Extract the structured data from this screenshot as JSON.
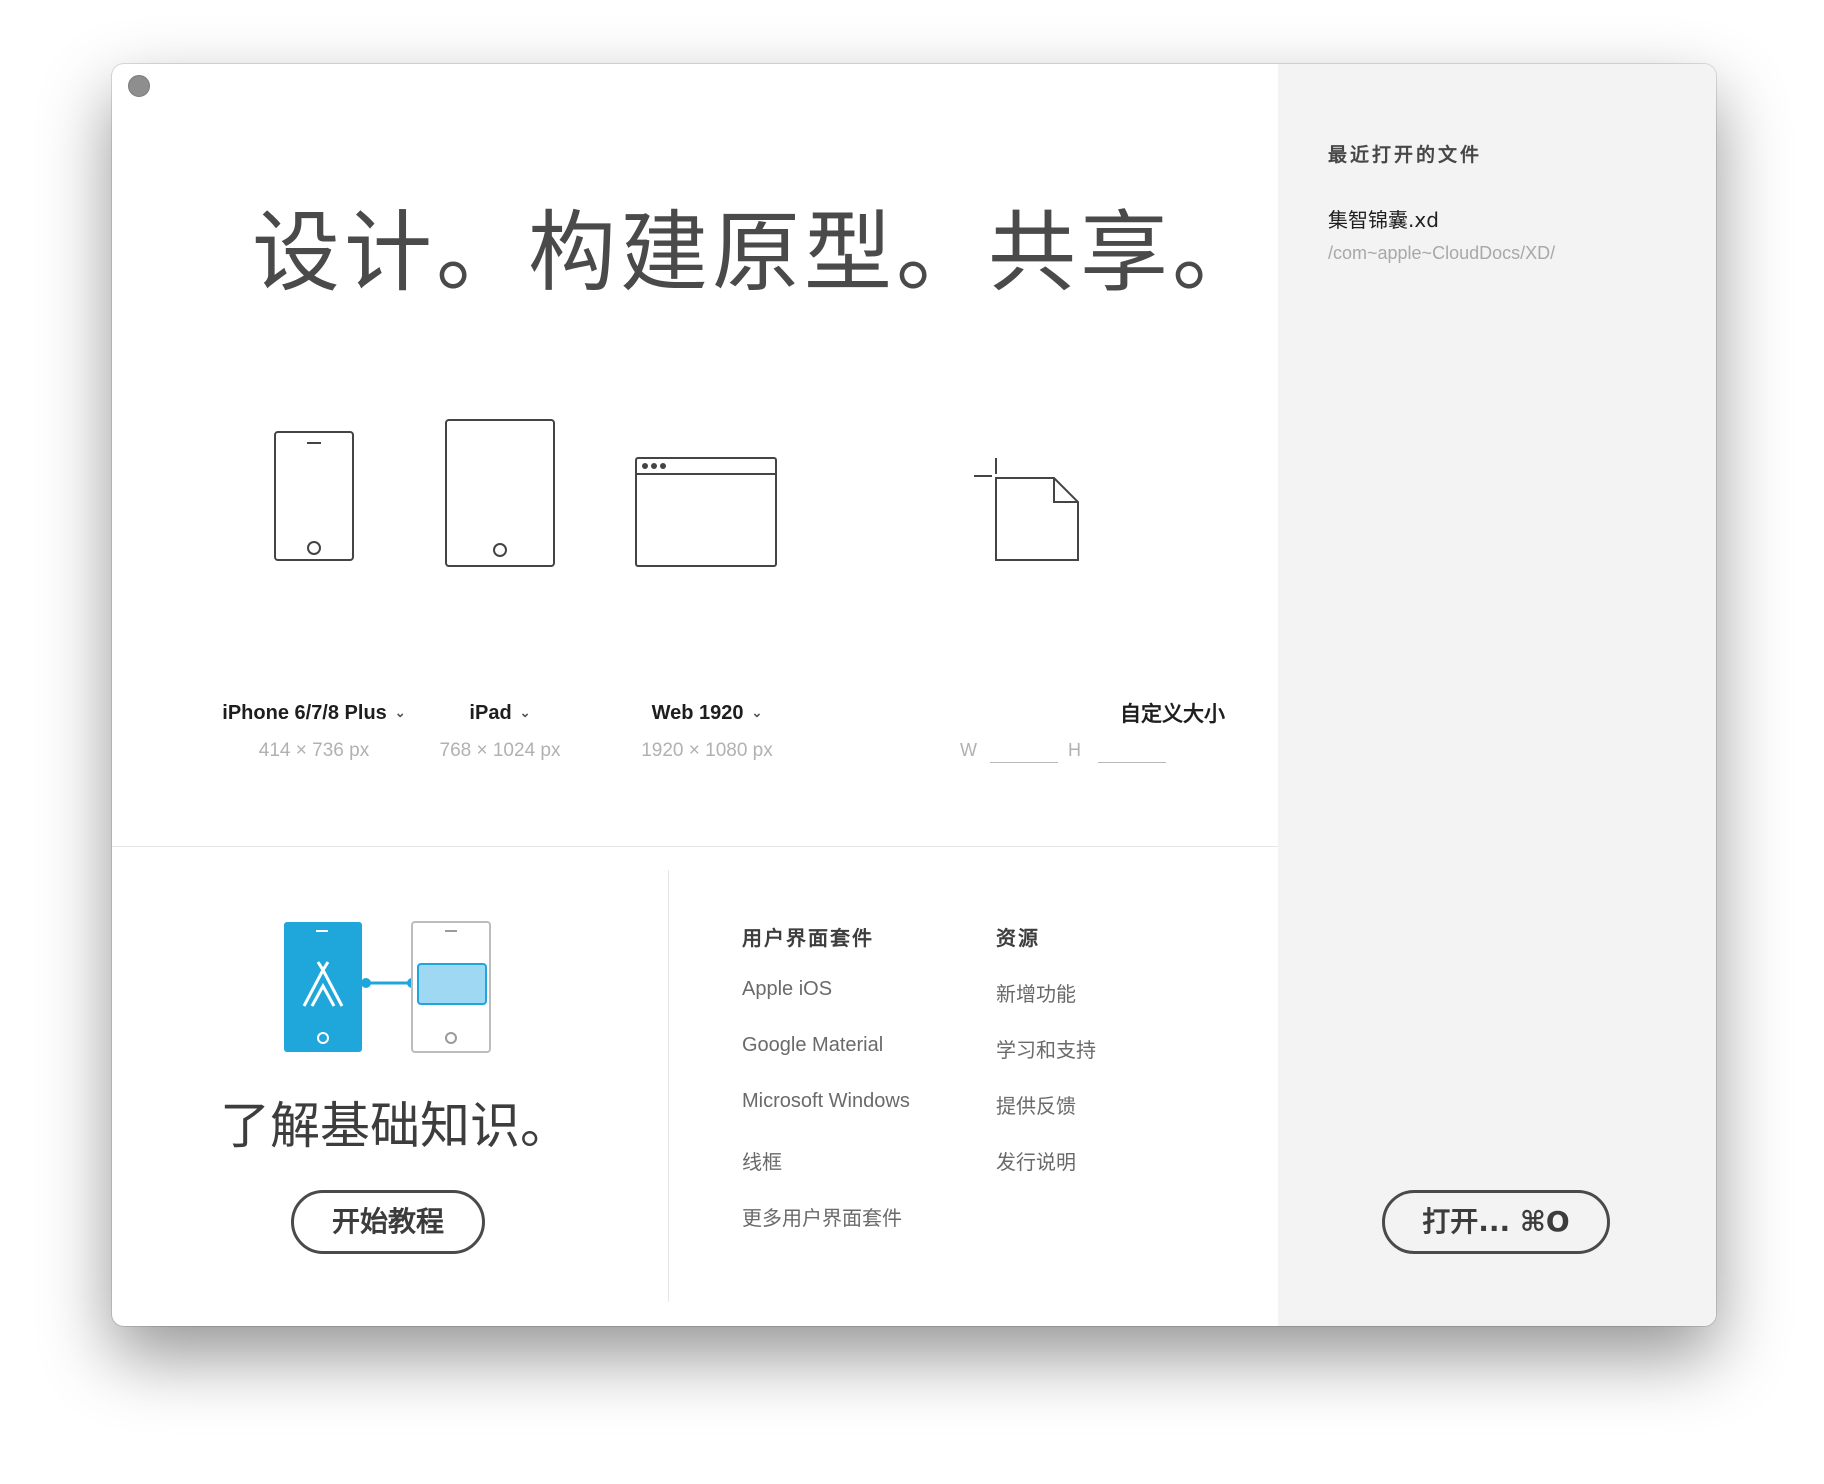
{
  "headline": "设计。构建原型。共享。",
  "presets": [
    {
      "label": "iPhone 6/7/8 Plus",
      "size": "414 × 736 px",
      "icon": "iphone-icon"
    },
    {
      "label": "iPad",
      "size": "768 × 1024 px",
      "icon": "ipad-icon"
    },
    {
      "label": "Web 1920",
      "size": "1920 × 1080 px",
      "icon": "web-browser-icon"
    }
  ],
  "custom": {
    "title": "自定义大小",
    "w_label": "W",
    "h_label": "H",
    "w_value": "",
    "h_value": ""
  },
  "learn": {
    "title": "了解基础知识。",
    "button": "开始教程"
  },
  "ui_kits": {
    "title": "用户界面套件",
    "items": [
      "Apple iOS",
      "Google Material",
      "Microsoft Windows",
      "线框",
      "更多用户界面套件"
    ]
  },
  "resources": {
    "title": "资源",
    "items": [
      "新增功能",
      "学习和支持",
      "提供反馈",
      "发行说明"
    ]
  },
  "recent": {
    "title": "最近打开的文件",
    "files": [
      {
        "name": "集智锦囊.xd",
        "path": "/com~apple~CloudDocs/XD/"
      }
    ]
  },
  "open_button": "打开...  ⌘O",
  "colors": {
    "accent_blue": "#1fa7dc",
    "light_blue": "#9ed8f2",
    "sidebar_bg": "#f3f3f3"
  }
}
